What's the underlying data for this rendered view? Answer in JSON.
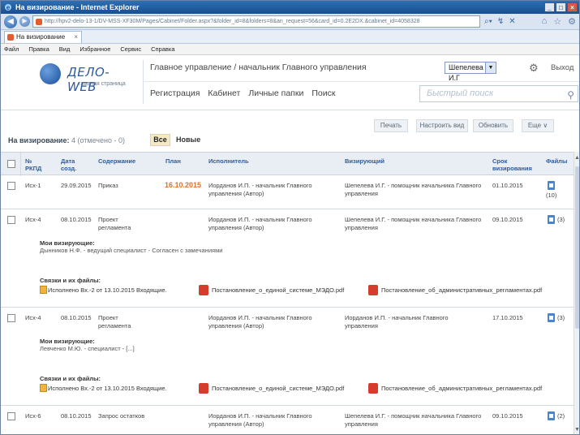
{
  "window": {
    "title": "На визирование - Internet Explorer"
  },
  "browser": {
    "url": "http://hpv2-delo-13-1/DV-MSS-XF30M/Pages/Cabinet/Folder.aspx?&folder_id=8&folders=8&an_request=56&card_id=0.2E2DX.&cabinet_id=4058328",
    "tab_label": "На визирование",
    "menu": [
      "Файл",
      "Правка",
      "Вид",
      "Избранное",
      "Сервис",
      "Справка"
    ]
  },
  "app": {
    "logo_text": "ДЕЛО-WEB",
    "logo_sub": "главная страница",
    "breadcrumb": "Главное управление / начальник Главного управления",
    "user": "Шепелева И.Г",
    "exit": "Выход",
    "nav": [
      "Регистрация",
      "Кабинет",
      "Личные папки",
      "Поиск"
    ],
    "search_placeholder": "Быстрый поиск"
  },
  "toolbar": {
    "print": "Печать",
    "configure_view": "Настроить вид",
    "refresh": "Обновить",
    "more": "Еще ∨"
  },
  "list": {
    "title": "На визирование:",
    "count": "4 (отмечено - 0)",
    "filter_all": "Все",
    "filter_new": "Новые"
  },
  "columns": {
    "num": "№ РКПД",
    "date": "Дата созд.",
    "content": "Содержание",
    "plan": "План",
    "executor": "Исполнитель",
    "approver": "Визирующий",
    "deadline": "Срок визирования",
    "files": "Файлы"
  },
  "rows": [
    {
      "num": "Исх-1",
      "date": "29.09.2015",
      "content": "Приказ",
      "plan": "16.10.2015",
      "executor": "Иорданов И.П. - начальник Главного управления (Автор)",
      "approver": "Шепелева И.Г. - помощник начальника Главного управления",
      "deadline": "01.10.2015",
      "files": "(10)"
    },
    {
      "num": "Исх-4",
      "date": "08.10.2015",
      "content": "Проект регламента",
      "plan": "",
      "executor": "Иорданов И.П. - начальник Главного управления (Автор)",
      "approver": "Шепелева И.Г. - помощник начальника Главного управления",
      "deadline": "09.10.2015",
      "files": "(3)",
      "my_approvers_label": "Мои визирующие:",
      "my_approvers": "Дынников Н.Ф. - ведущий специалист - Согласен с замечаниями",
      "links_label": "Связки и их файлы:",
      "links": [
        "Исполнено Вх.-2 от 13.10.2015 Входящие.",
        "Постановление_о_единой_системе_МЭДО.pdf",
        "Постановление_об_административных_регламентах.pdf"
      ]
    },
    {
      "num": "Исх-4",
      "date": "08.10.2015",
      "content": "Проект регламента",
      "plan": "",
      "executor": "Иорданов И.П. - начальник Главного управления (Автор)",
      "approver": "Иорданов И.П. - начальник Главного управления",
      "deadline": "17.10.2015",
      "files": "(3)",
      "my_approvers_label": "Мои визирующие:",
      "my_approvers": "Левченко М.Ю. - специалист - [...]",
      "links_label": "Связки и их файлы:",
      "links": [
        "Исполнено Вх.-2 от 13.10.2015 Входящие.",
        "Постановление_о_единой_системе_МЭДО.pdf",
        "Постановление_об_административных_регламентах.pdf"
      ]
    },
    {
      "num": "Исх-6",
      "date": "08.10.2015",
      "content": "Запрос остатков",
      "plan": "",
      "executor": "Иорданов И.П. - начальник Главного управления (Автор)",
      "approver": "Шепелева И.Г. - помощник начальника Главного управления",
      "deadline": "09.10.2015",
      "files": "(2)"
    }
  ]
}
